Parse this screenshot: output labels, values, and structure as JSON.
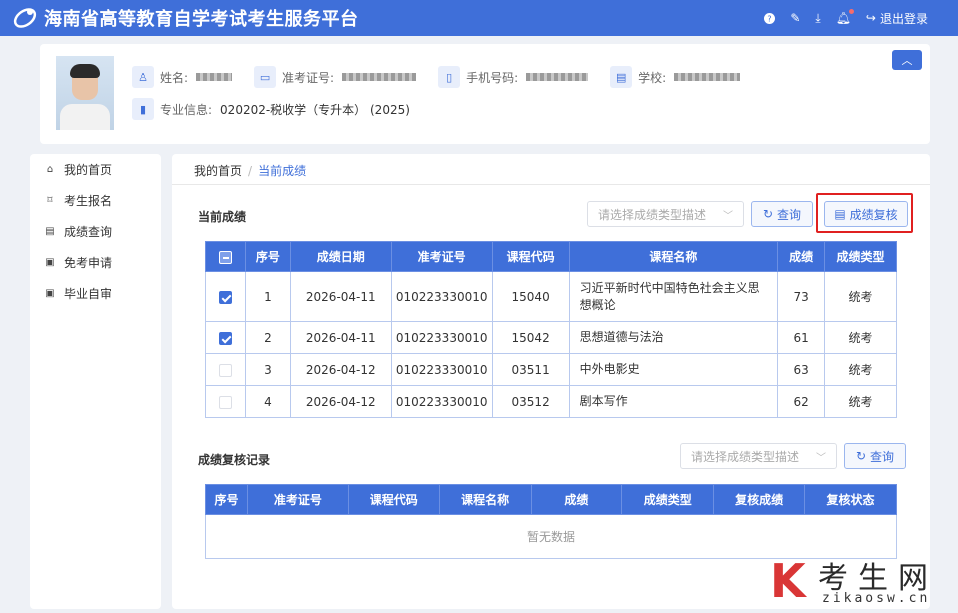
{
  "header": {
    "title": "海南省高等教育自学考试考生服务平台",
    "logout_label": "退出登录"
  },
  "profile": {
    "name_label": "姓名:",
    "ticket_label": "准考证号:",
    "phone_label": "手机号码:",
    "school_label": "学校:",
    "major_label": "专业信息:",
    "major_value": "020202-税收学（专升本） (2025)"
  },
  "sidebar": {
    "items": [
      {
        "label": "我的首页",
        "icon": "home-icon"
      },
      {
        "label": "考生报名",
        "icon": "bookmark-icon"
      },
      {
        "label": "成绩查询",
        "icon": "document-icon"
      },
      {
        "label": "免考申请",
        "icon": "form-icon"
      },
      {
        "label": "毕业自审",
        "icon": "form-icon"
      }
    ]
  },
  "breadcrumb": {
    "home": "我的首页",
    "separator": "/",
    "current": "当前成绩"
  },
  "current_scores": {
    "title": "当前成绩",
    "select_placeholder": "请选择成绩类型描述",
    "query_label": "查询",
    "review_label": "成绩复核",
    "columns": [
      "序号",
      "成绩日期",
      "准考证号",
      "课程代码",
      "课程名称",
      "成绩",
      "成绩类型"
    ],
    "rows": [
      {
        "checked": true,
        "index": "1",
        "date": "2026-04-11",
        "ticket": "010223330010",
        "code": "15040",
        "name": "习近平新时代中国特色社会主义思想概论",
        "score": "73",
        "type": "统考"
      },
      {
        "checked": true,
        "index": "2",
        "date": "2026-04-11",
        "ticket": "010223330010",
        "code": "15042",
        "name": "思想道德与法治",
        "score": "61",
        "type": "统考"
      },
      {
        "checked": false,
        "index": "3",
        "date": "2026-04-12",
        "ticket": "010223330010",
        "code": "03511",
        "name": "中外电影史",
        "score": "63",
        "type": "统考"
      },
      {
        "checked": false,
        "index": "4",
        "date": "2026-04-12",
        "ticket": "010223330010",
        "code": "03512",
        "name": "剧本写作",
        "score": "62",
        "type": "统考"
      }
    ]
  },
  "review_records": {
    "title": "成绩复核记录",
    "select_placeholder": "请选择成绩类型描述",
    "query_label": "查询",
    "columns": [
      "序号",
      "准考证号",
      "课程代码",
      "课程名称",
      "成绩",
      "成绩类型",
      "复核成绩",
      "复核状态"
    ],
    "empty_text": "暂无数据"
  },
  "watermark": {
    "letter": "K",
    "chinese": "考生网",
    "url": "zikaosw.cn"
  },
  "colors": {
    "primary": "#3f6fd9",
    "highlight": "#e02020"
  }
}
